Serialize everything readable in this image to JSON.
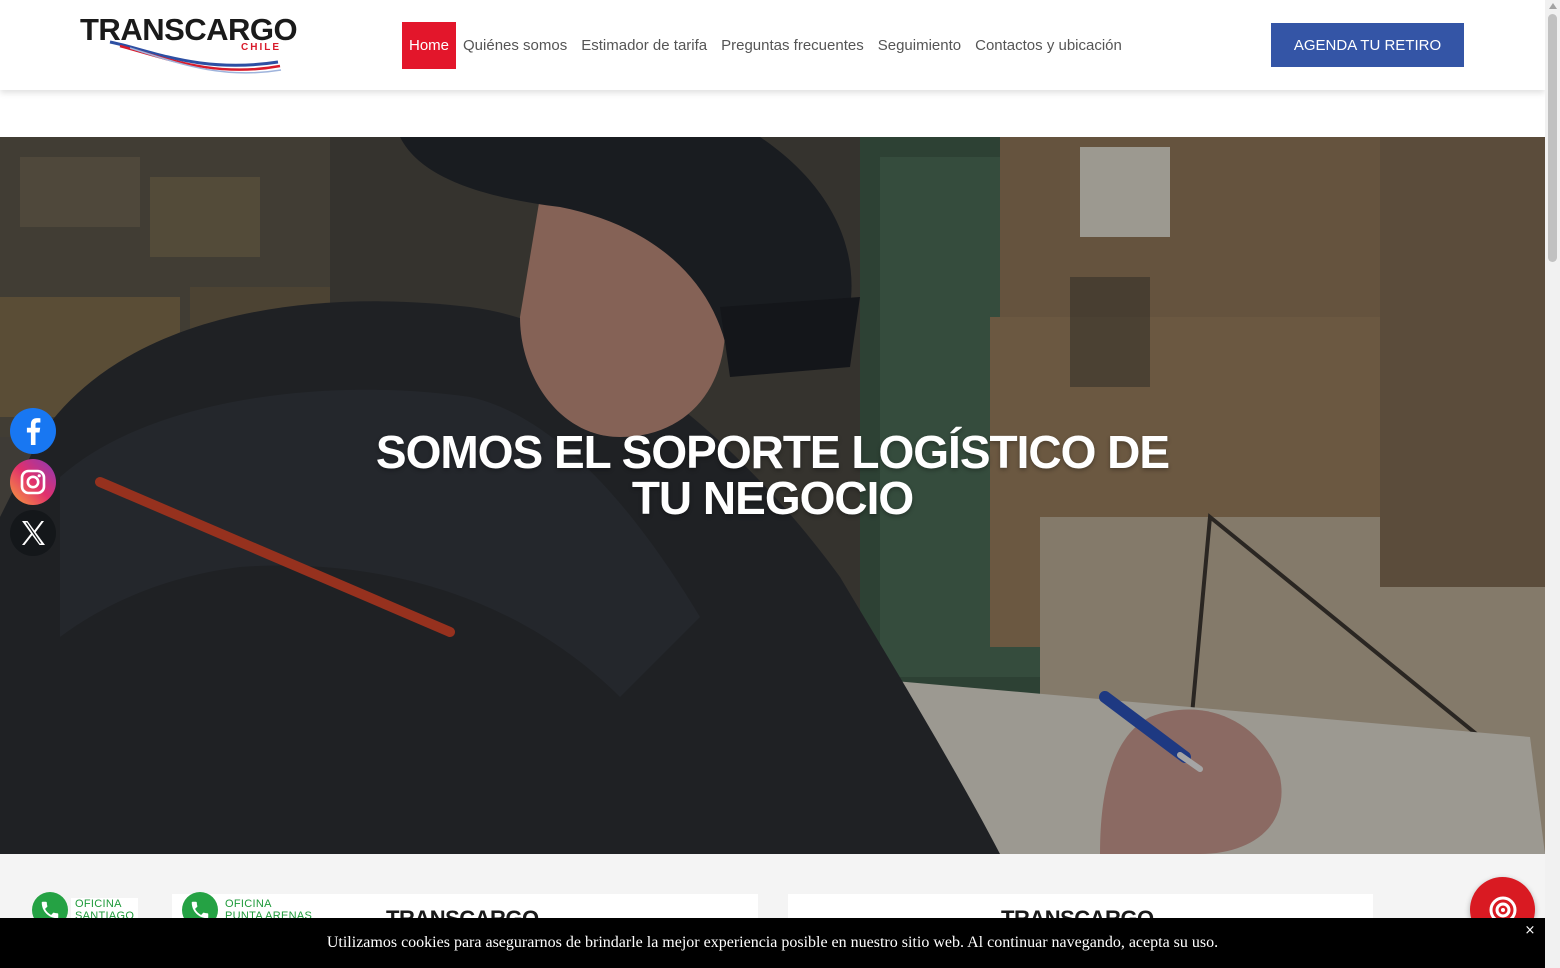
{
  "header": {
    "logo": {
      "main": "TRANSCARGO",
      "sub": "CHILE"
    },
    "nav": [
      {
        "label": "Home",
        "active": true
      },
      {
        "label": "Quiénes somos"
      },
      {
        "label": "Estimador de tarifa"
      },
      {
        "label": "Preguntas frecuentes"
      },
      {
        "label": "Seguimiento"
      },
      {
        "label": "Contactos y ubicación"
      }
    ],
    "cta_label": "AGENDA TU RETIRO"
  },
  "hero": {
    "title_line1": "SOMOS EL SOPORTE LOGÍSTICO DE",
    "title_line2": "TU NEGOCIO"
  },
  "social": [
    {
      "name": "facebook",
      "icon": "facebook-icon",
      "color": "#1877f2"
    },
    {
      "name": "instagram",
      "icon": "instagram-icon"
    },
    {
      "name": "x",
      "icon": "x-icon",
      "color": "#14171a"
    }
  ],
  "whatsapp": [
    {
      "line1": "OFICINA",
      "line2": "SANTIAGO"
    },
    {
      "line1": "OFICINA",
      "line2": "PUNTA ARENAS"
    }
  ],
  "cards": [
    {
      "logo": "TRANSCARGO"
    },
    {
      "logo": "TRANSCARGO"
    }
  ],
  "chat": {
    "icon": "chat-target-icon",
    "color": "#d91a22"
  },
  "cookie": {
    "text": "Utilizamos cookies para asegurarnos de brindarle la mejor experiencia posible en nuestro sitio web. Al continuar navegando, acepta su uso.",
    "close": "×"
  },
  "colors": {
    "brand_red": "#e3162b",
    "brand_blue": "#3455a6",
    "whatsapp_green": "#25a244"
  }
}
